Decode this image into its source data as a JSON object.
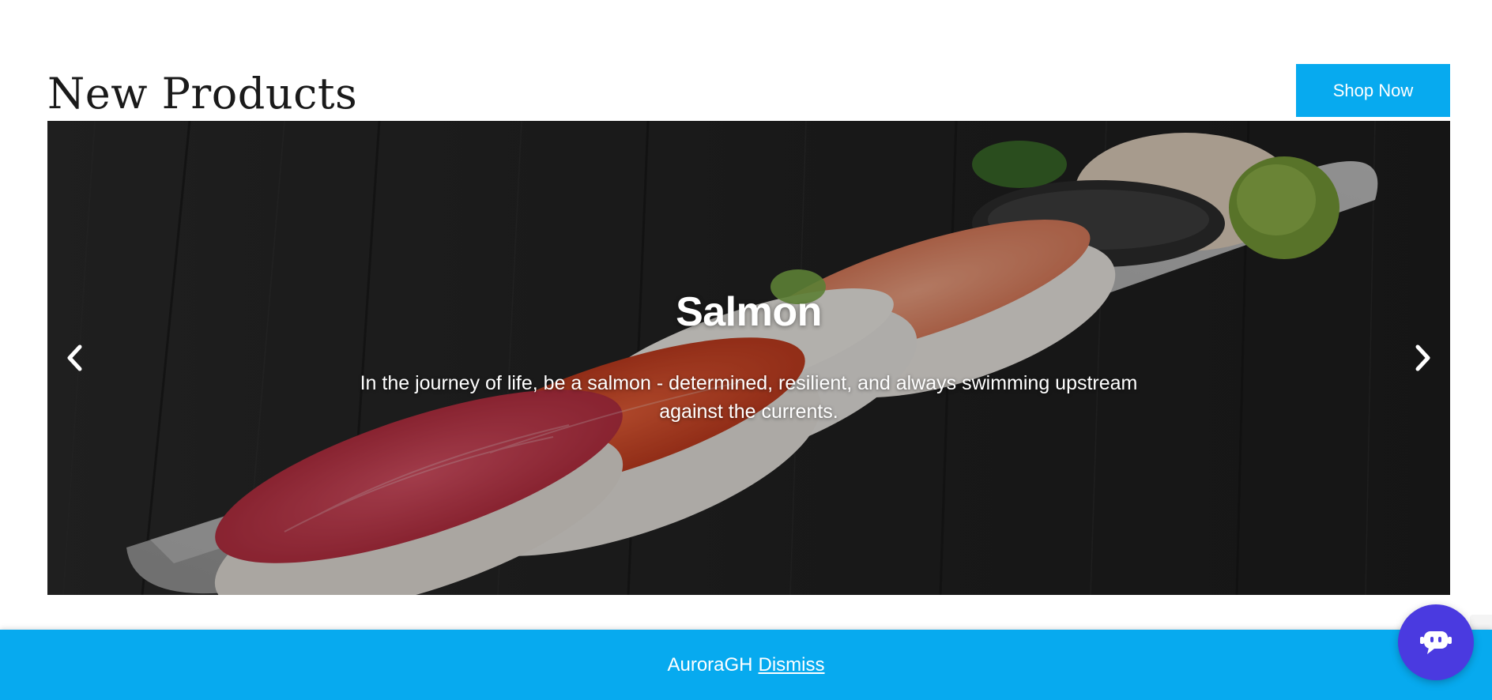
{
  "section": {
    "title": "New Products",
    "shop_button_label": "Shop Now"
  },
  "carousel": {
    "slide": {
      "title": "Salmon",
      "text": "In the journey of life, be a salmon - determined, resilient, and always swimming upstream against the currents."
    },
    "prev_icon": "chevron-left-icon",
    "next_icon": "chevron-right-icon"
  },
  "cookie_bar": {
    "brand": "AuroraGH",
    "dismiss_label": "Dismiss",
    "background_color": "#07aaef"
  },
  "chat_widget": {
    "icon": "chatbot-icon",
    "color": "#4a3ae0"
  },
  "colors": {
    "accent": "#07aaef",
    "chat": "#4a3ae0"
  }
}
